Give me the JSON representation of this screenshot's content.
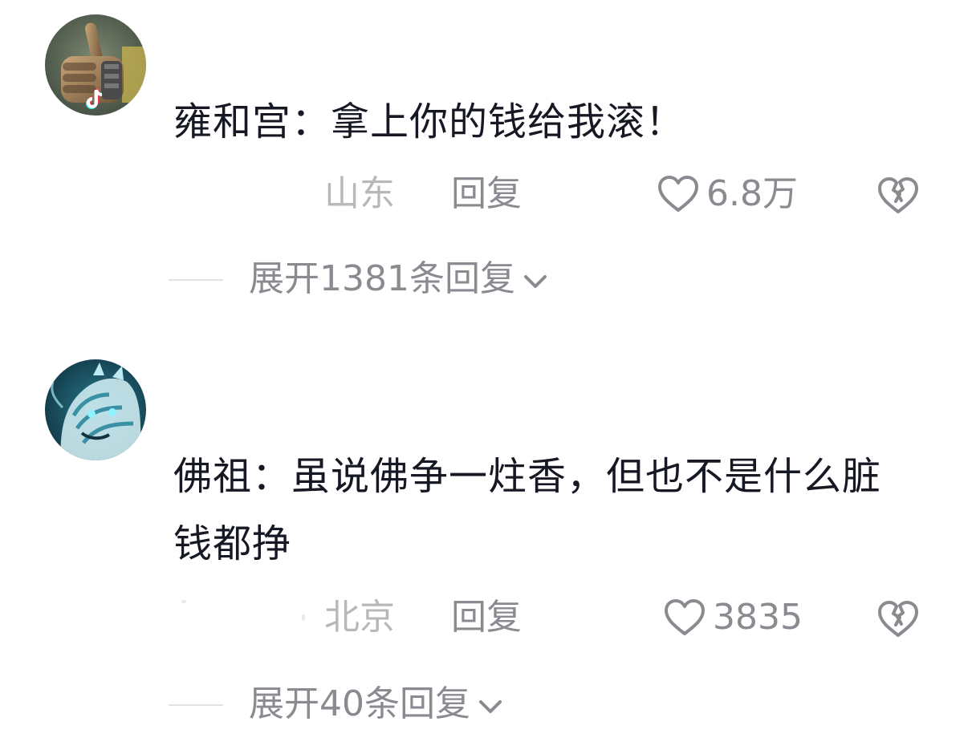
{
  "comments": [
    {
      "text": "雍和宫：拿上你的钱给我滚！",
      "location": "山东",
      "reply_label": "回复",
      "likes": "6.8万",
      "expand_label": "展开1381条回复"
    },
    {
      "text": "佛祖：虽说佛争一炷香，但也不是什么脏钱都挣",
      "location": "北京",
      "reply_label": "回复",
      "likes": "3835",
      "expand_label": "展开40条回复"
    }
  ],
  "icons": {
    "like": "heart-outline-icon",
    "dislike": "broken-heart-icon",
    "expand": "chevron-down-icon",
    "badge": "tiktok-logo-icon"
  },
  "colors": {
    "text_primary": "#161823",
    "text_secondary": "#8a8b91",
    "text_location": "#b8b8bb",
    "divider": "#e2e2e4"
  }
}
